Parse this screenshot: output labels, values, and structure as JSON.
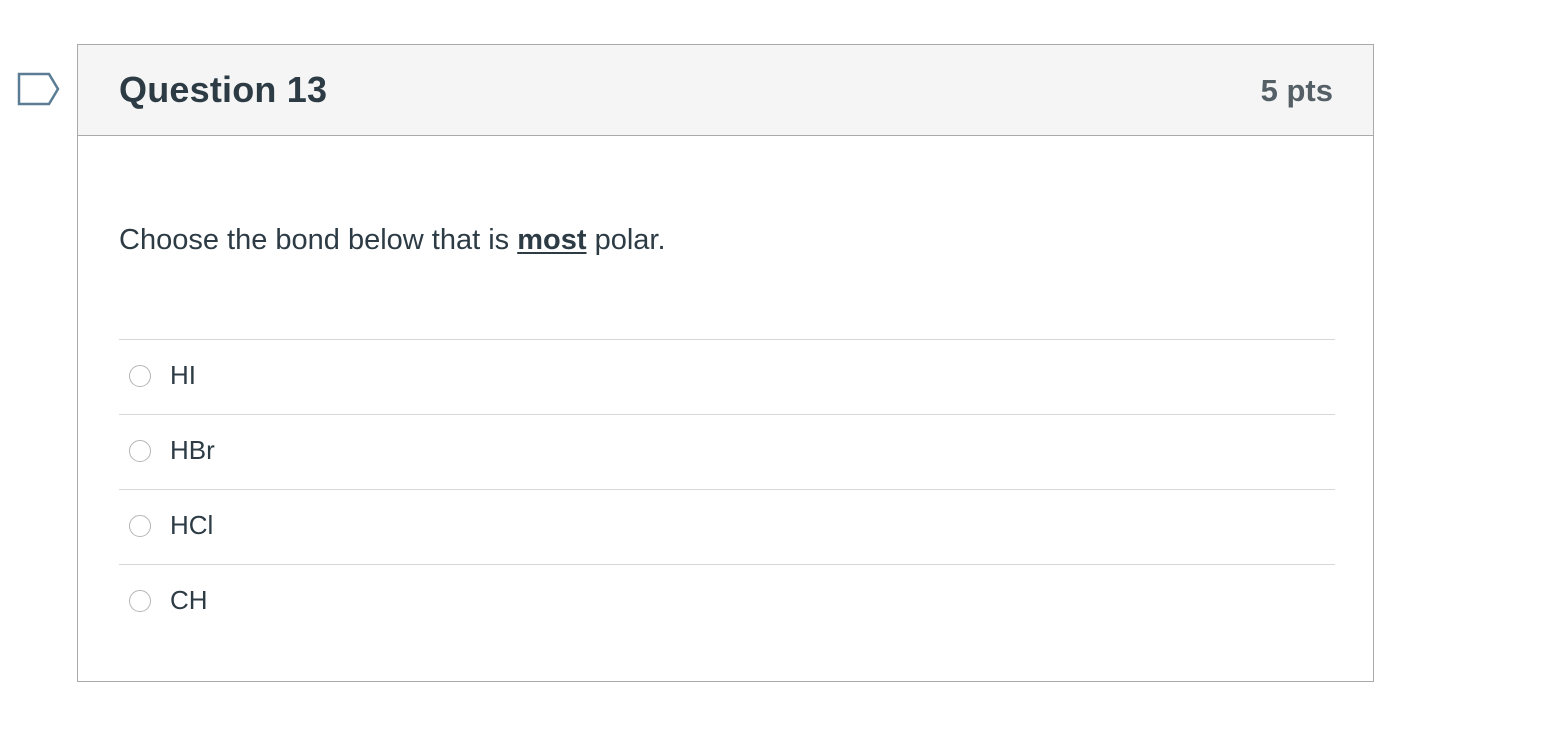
{
  "question": {
    "title": "Question 13",
    "points": "5 pts",
    "text_before": "Choose the bond below that is ",
    "text_emphasis": "most",
    "text_after": " polar.",
    "answers": [
      {
        "label": "HI"
      },
      {
        "label": "HBr"
      },
      {
        "label": "HCl"
      },
      {
        "label": "CH"
      }
    ]
  },
  "colors": {
    "header_bg": "#f5f5f5",
    "border": "#aaaaaa",
    "text": "#2d3b45",
    "flag": "#5a7d95"
  },
  "icons": {
    "flag": "flag-bookmark-icon"
  }
}
